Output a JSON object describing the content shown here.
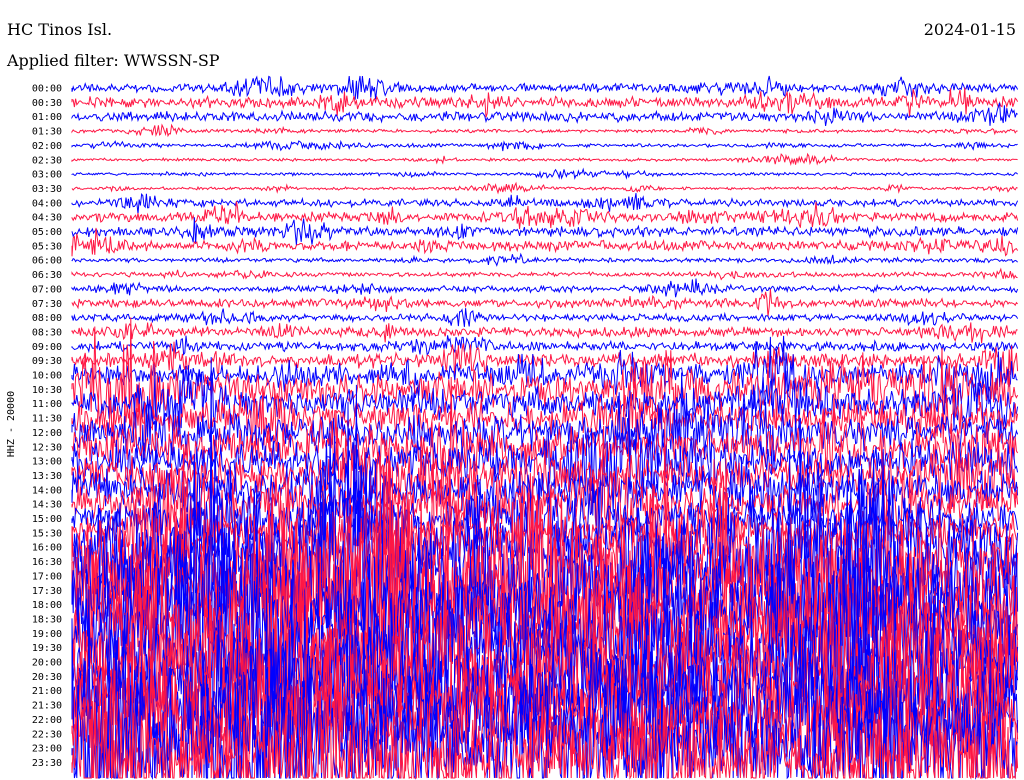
{
  "header": {
    "station": "HC Tinos Isl.",
    "date": "2024-01-15",
    "filter": "Applied filter: WWSSN-SP"
  },
  "chart_data": {
    "type": "line",
    "title": "HC Tinos Isl.",
    "ylabel": "HHZ - 20000",
    "colors": [
      "#0000ff",
      "#ff1744"
    ],
    "series_traces": [
      {
        "label": "00:00",
        "activity": 0.35
      },
      {
        "label": "00:30",
        "activity": 0.45
      },
      {
        "label": "01:00",
        "activity": 0.4
      },
      {
        "label": "01:30",
        "activity": 0.15
      },
      {
        "label": "02:00",
        "activity": 0.15
      },
      {
        "label": "02:30",
        "activity": 0.12
      },
      {
        "label": "03:00",
        "activity": 0.12
      },
      {
        "label": "03:30",
        "activity": 0.12
      },
      {
        "label": "04:00",
        "activity": 0.3
      },
      {
        "label": "04:30",
        "activity": 0.4
      },
      {
        "label": "05:00",
        "activity": 0.4
      },
      {
        "label": "05:30",
        "activity": 0.4
      },
      {
        "label": "06:00",
        "activity": 0.18
      },
      {
        "label": "06:30",
        "activity": 0.2
      },
      {
        "label": "07:00",
        "activity": 0.25
      },
      {
        "label": "07:30",
        "activity": 0.35
      },
      {
        "label": "08:00",
        "activity": 0.3
      },
      {
        "label": "08:30",
        "activity": 0.4
      },
      {
        "label": "09:00",
        "activity": 0.4
      },
      {
        "label": "09:30",
        "activity": 0.6
      },
      {
        "label": "10:00",
        "activity": 0.9
      },
      {
        "label": "10:30",
        "activity": 1.4
      },
      {
        "label": "11:00",
        "activity": 1.3
      },
      {
        "label": "11:30",
        "activity": 1.4
      },
      {
        "label": "12:00",
        "activity": 1.5
      },
      {
        "label": "12:30",
        "activity": 1.6
      },
      {
        "label": "13:00",
        "activity": 1.6
      },
      {
        "label": "13:30",
        "activity": 1.6
      },
      {
        "label": "14:00",
        "activity": 1.6
      },
      {
        "label": "14:30",
        "activity": 1.5
      },
      {
        "label": "15:00",
        "activity": 1.4
      },
      {
        "label": "15:30",
        "activity": 1.5
      },
      {
        "label": "16:00",
        "activity": 2.6
      },
      {
        "label": "16:30",
        "activity": 3.6
      },
      {
        "label": "17:00",
        "activity": 4.0
      },
      {
        "label": "17:30",
        "activity": 4.0
      },
      {
        "label": "18:00",
        "activity": 4.0
      },
      {
        "label": "18:30",
        "activity": 4.0
      },
      {
        "label": "19:00",
        "activity": 4.0
      },
      {
        "label": "19:30",
        "activity": 4.0
      },
      {
        "label": "20:00",
        "activity": 4.0
      },
      {
        "label": "20:30",
        "activity": 4.0
      },
      {
        "label": "21:00",
        "activity": 4.0
      },
      {
        "label": "21:30",
        "activity": 4.0
      },
      {
        "label": "22:00",
        "activity": 4.0
      },
      {
        "label": "22:30",
        "activity": 4.0
      },
      {
        "label": "23:00",
        "activity": 4.0
      },
      {
        "label": "23:30",
        "activity": 4.0
      }
    ]
  }
}
